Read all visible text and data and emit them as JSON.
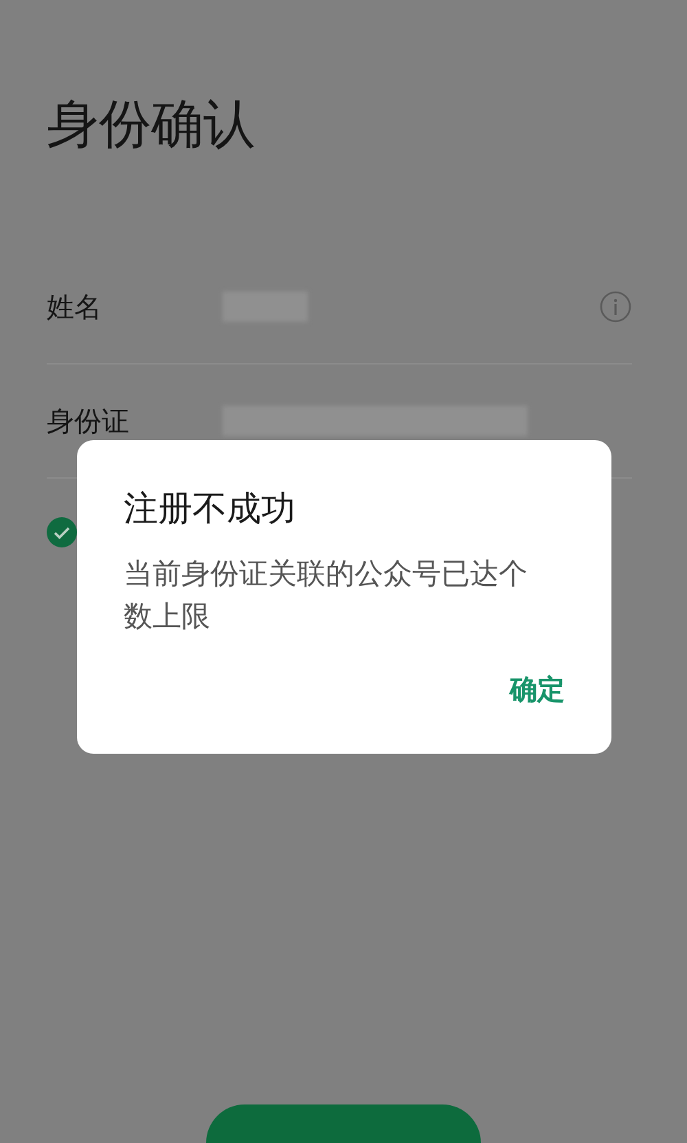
{
  "page": {
    "title": "身份确认"
  },
  "fields": [
    {
      "label": "姓名",
      "value_redacted": true,
      "info": true
    },
    {
      "label": "身份证",
      "value_redacted": true,
      "info": false
    }
  ],
  "agreement": {
    "checked": true
  },
  "dialog": {
    "title": "注册不成功",
    "message": "当前身份证关联的公众号已达个数上限",
    "button": "确定"
  },
  "confirm_button": {
    "kind": "primary"
  }
}
